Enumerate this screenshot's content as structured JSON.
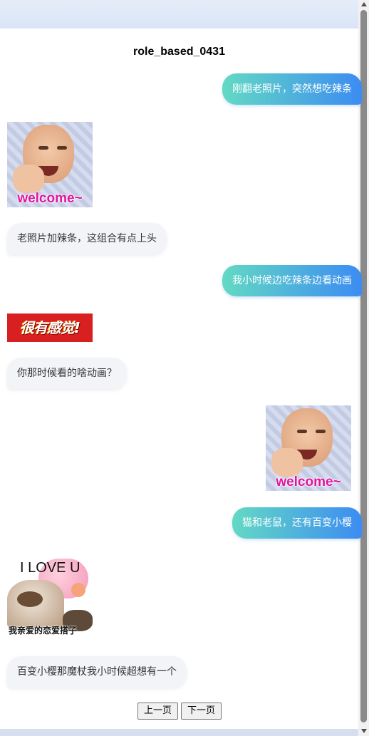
{
  "chat": {
    "title": "role_based_0431",
    "messages": [
      {
        "role": "user",
        "type": "text",
        "text": "刚翻老照片，突然想吃辣条"
      },
      {
        "role": "bot",
        "type": "sticker",
        "sticker": "baby-welcome",
        "caption": "welcome~"
      },
      {
        "role": "bot",
        "type": "text",
        "text": "老照片加辣条，这组合有点上头"
      },
      {
        "role": "user",
        "type": "text",
        "text": "我小时候边吃辣条边看动画"
      },
      {
        "role": "bot",
        "type": "sticker",
        "sticker": "feeling",
        "caption": "很有感觉!"
      },
      {
        "role": "bot",
        "type": "text",
        "text": "你那时候看的啥动画？"
      },
      {
        "role": "user",
        "type": "sticker",
        "sticker": "baby-welcome",
        "caption": "welcome~"
      },
      {
        "role": "user",
        "type": "text",
        "text": "猫和老鼠，还有百变小樱"
      },
      {
        "role": "bot",
        "type": "sticker",
        "sticker": "cat-love",
        "caption_top": "I LOVE U",
        "caption_bottom": "我亲爱的恋爱搭子"
      },
      {
        "role": "bot",
        "type": "text",
        "text": "百变小樱那魔杖我小时候超想有一个"
      }
    ]
  },
  "pagination": {
    "prev_label": "上一页",
    "next_label": "下一页"
  },
  "colors": {
    "user_bubble_start": "#63d9c4",
    "user_bubble_end": "#3c8cf2",
    "bot_bubble": "#f2f4f8"
  }
}
